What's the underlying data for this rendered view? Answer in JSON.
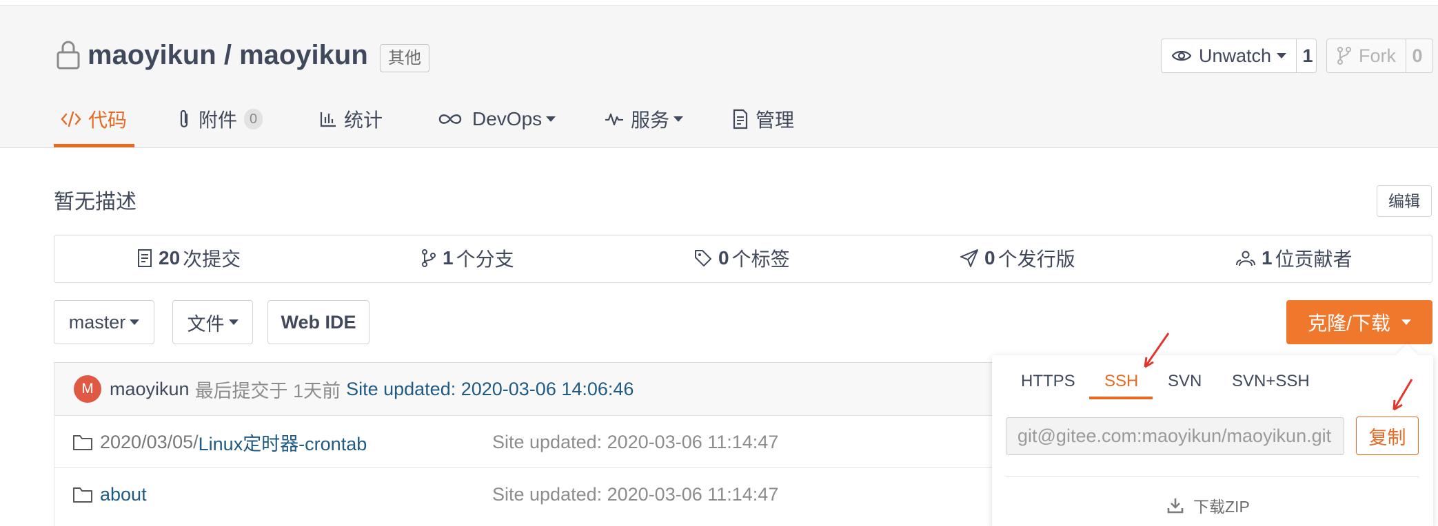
{
  "repo": {
    "owner": "maoyikun",
    "separator": " / ",
    "name": "maoyikun",
    "badge": "其他",
    "watch_label": "Unwatch",
    "watch_count": "1",
    "fork_label": "Fork",
    "fork_count": "0"
  },
  "nav": {
    "code": "代码",
    "attachments": "附件",
    "attachments_count": "0",
    "stats": "统计",
    "devops": "DevOps",
    "services": "服务",
    "manage": "管理"
  },
  "description": {
    "text": "暂无描述",
    "edit_label": "编辑"
  },
  "stats": {
    "commits_num": "20",
    "commits_label": "次提交",
    "branches_num": "1",
    "branches_label": "个分支",
    "tags_num": "0",
    "tags_label": "个标签",
    "releases_num": "0",
    "releases_label": "个发行版",
    "contributors_num": "1",
    "contributors_label": "位贡献者"
  },
  "toolbar": {
    "branch": "master",
    "files": "文件",
    "web_ide": "Web IDE",
    "clone": "克隆/下载"
  },
  "last_commit": {
    "avatar_letter": "M",
    "user": "maoyikun",
    "meta": "最后提交于 1天前",
    "message": "Site updated: 2020-03-06 14:06:46"
  },
  "files": [
    {
      "prefix": "2020/03/05/",
      "name": "Linux定时器-crontab",
      "commit": "Site updated: 2020-03-06 11:14:47"
    },
    {
      "prefix": "",
      "name": "about",
      "commit": "Site updated: 2020-03-06 11:14:47"
    }
  ],
  "clone_popup": {
    "tabs": [
      "HTTPS",
      "SSH",
      "SVN",
      "SVN+SSH"
    ],
    "active_tab": "SSH",
    "url": "git@gitee.com:maoyikun/maoyikun.git",
    "copy_label": "复制",
    "zip_label": "下载ZIP"
  },
  "colors": {
    "accent": "#e86a22",
    "clone_button": "#f0782d",
    "link": "#1f5a83",
    "avatar": "#e05a43"
  }
}
